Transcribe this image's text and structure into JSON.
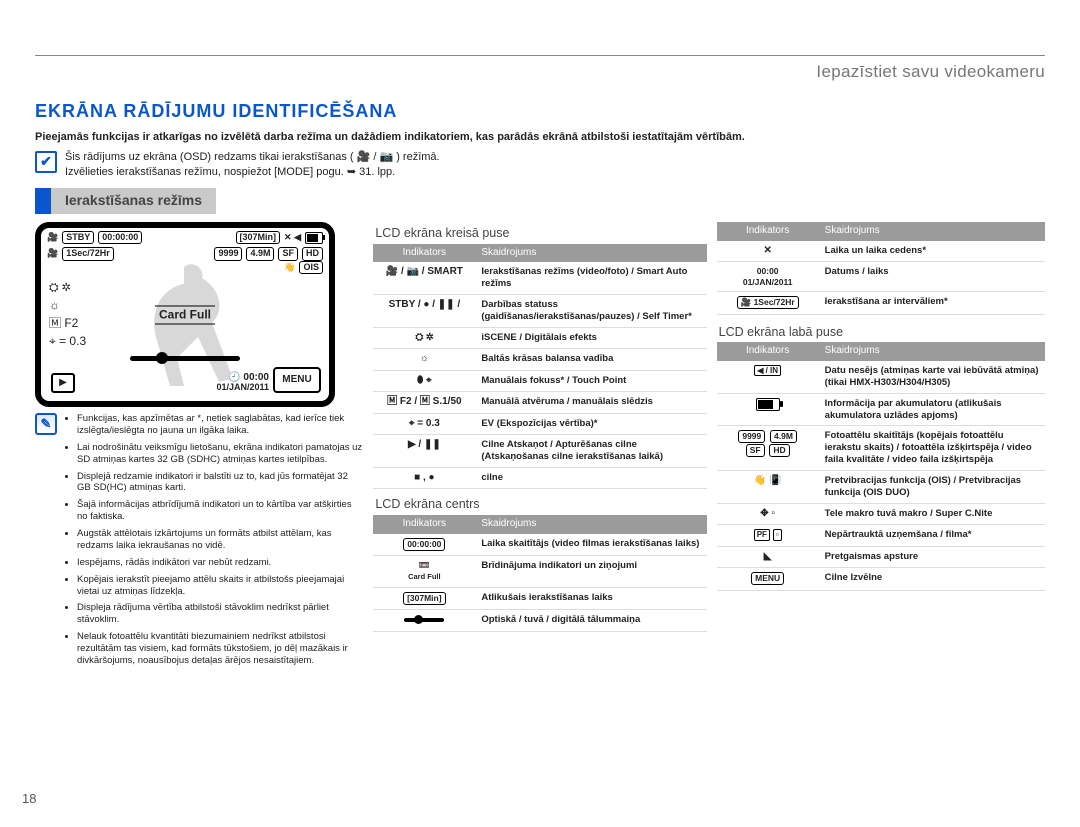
{
  "breadcrumb": "Iepazīstiet savu videokameru",
  "title": "EKRĀNA RĀDĪJUMU IDENTIFICĒŠANA",
  "intro": "Pieejamās funkcijas ir atkarīgas no izvēlētā darba režīma un dažādiem indikatoriem, kas parādās ekrānā atbilstoši iestatītajām vērtībām.",
  "tick_bullets": [
    "Šis rādījums uz ekrāna (OSD) redzams tikai ierakstīšanas ( 🎥 / 📷 ) režīmā.",
    "Izvēlieties ierakstīšanas režīmu, nospiežot [MODE] pogu. ➥ 31. lpp."
  ],
  "mode_label": "Ierakstīšanas režīms",
  "lcd": {
    "stby": "STBY",
    "timer": "00:00:00",
    "remain": "[307Min]",
    "interval": "1Sec/72Hr",
    "shots": "9999",
    "mp": "4.9M",
    "cardfull": "Card Full",
    "expo": "⌖ = 0.3",
    "focus": "🄼 F2",
    "menu": "MENU",
    "time": "00:00",
    "date": "01/JAN/2011"
  },
  "notes": [
    "Funkcijas, kas apzīmētas ar *, netiek saglabātas, kad ierīce tiek izslēgta/ieslēgta no jauna un ilgāka laika.",
    "Lai nodrošinātu veiksmīgu lietošanu, ekrāna indikatori pamatojas uz SD atmiņas kartes 32 GB (SDHC) atmiņas kartes ietilpības.",
    "Displejā redzamie indikatori ir balstīti uz to, kad jūs formatējat 32 GB SD(HC) atmiņas karti.",
    "Šajā informācijas atbrīdījumā indikatori un to kārtība var atšķirties no faktiska.",
    "Augstāk attēlotais izkārtojums un formāts atbilst attēlam, kas redzams laika iekraušanas no vidē.",
    "Iespējams, rādās indikātori var nebūt redzami.",
    "Kopējais ierakstīt pieejamo attēlu skaits ir atbilstošs pieejamajai vietai uz atmiņas līdzekļa.",
    "Displeja rādījuma vērtība atbilstoši stāvoklim nedrīkst pārliet stāvoklim.",
    "Nelauk fotoattēlu kvantitāti biezumainiem nedrīkst atbilstosi rezultātām tas visiem, kad formāts tūkstošiem, jo dēļ mazākais ir divkāršojums, noausībojus detaļas ārējos nesaistītajiem."
  ],
  "sections": {
    "left_title": "LCD ekrāna kreisā puse",
    "center_title": "LCD ekrāna centrs",
    "right_title": "LCD ekrāna labā puse"
  },
  "tables": {
    "head_ind": "Indikators",
    "head_desc": "Skaidrojums",
    "left": [
      {
        "ind": "🎥 / 📷 / SMART",
        "desc": "Ierakstīšanas režīms (video/foto) / Smart Auto režīms"
      },
      {
        "ind": "STBY / ● / ❚❚ /",
        "desc": "Darbības statuss (gaidīšanas/ierakstīšanas/pauzes) / Self Timer*"
      },
      {
        "ind": "⛭ ✲",
        "desc": "iSCENE / Digitālais efekts"
      },
      {
        "ind": "☼",
        "desc": "Baltās krāsas balansa vadība"
      },
      {
        "ind": "⬮ ⌖",
        "desc": "Manuālais fokuss* / Touch Point"
      },
      {
        "ind": "🄼 F2 / 🄼 S.1/50",
        "desc": "Manuālā atvēruma / manuālais slēdzis"
      },
      {
        "ind": "⌖ = 0.3",
        "desc": "EV (Ekspozīcijas vērtība)*"
      },
      {
        "ind": "▶ / ❚❚",
        "desc": "Cilne Atskaņot / Apturēšanas cilne (Atskaņošanas cilne ierakstīšanas laikā)"
      },
      {
        "ind": "■ , ●",
        "desc": "cilne"
      }
    ],
    "center": [
      {
        "ind": "00:00:00",
        "desc": "Laika skaitītājs (video filmas ierakstīšanas laiks)"
      },
      {
        "ind": "Card Full",
        "desc": "Brīdinājuma indikatori un ziņojumi"
      },
      {
        "ind": "[307Min]",
        "desc": "Atlikušais ierakstīšanas laiks"
      },
      {
        "ind": "[zoom bar]",
        "desc": "Optiskā / tuvā / digitālā tālummaiņa"
      }
    ],
    "upper_right": [
      {
        "ind": "✕",
        "desc": "Laika un laika cedens*"
      },
      {
        "ind": "00:00\n01/JAN/2011",
        "desc": "Datums / laiks"
      },
      {
        "ind": "🎥 1Sec/72Hr",
        "desc": "Ierakstīšana ar intervāliem*"
      }
    ],
    "right": [
      {
        "ind": "◀ / IN",
        "desc": "Datu nesējs (atmiņas karte vai iebūvātā atmiņa) (tikai HMX-H303/H304/H305)"
      },
      {
        "ind": "batt",
        "desc": "Informācija par akumulatoru (atlikušais akumulatora uzlādes apjoms)"
      },
      {
        "ind": "9999 4.9M",
        "desc": "Fotoattēlu skaitītājs (kopējais fotoattēlu ierakstu skaits) / fotoattēla izšķirtspēja / video faila kvalitāte / video faila izšķirtspēja"
      },
      {
        "ind": "👋 📳",
        "desc": "Pretvibracijas funkcija (OIS) / Pretvibracijas funkcija (OIS DUO)"
      },
      {
        "ind": "✥ ▫",
        "desc": "Tele makro tuvā makro / Super C.Nite"
      },
      {
        "ind": "PF ▫",
        "desc": "Nepārtrauktā uzņemšana / filma*"
      },
      {
        "ind": "◣",
        "desc": "Pretgaismas apsture"
      },
      {
        "ind": "MENU",
        "desc": "Cilne Izvēlne"
      }
    ]
  },
  "page_number": "18"
}
